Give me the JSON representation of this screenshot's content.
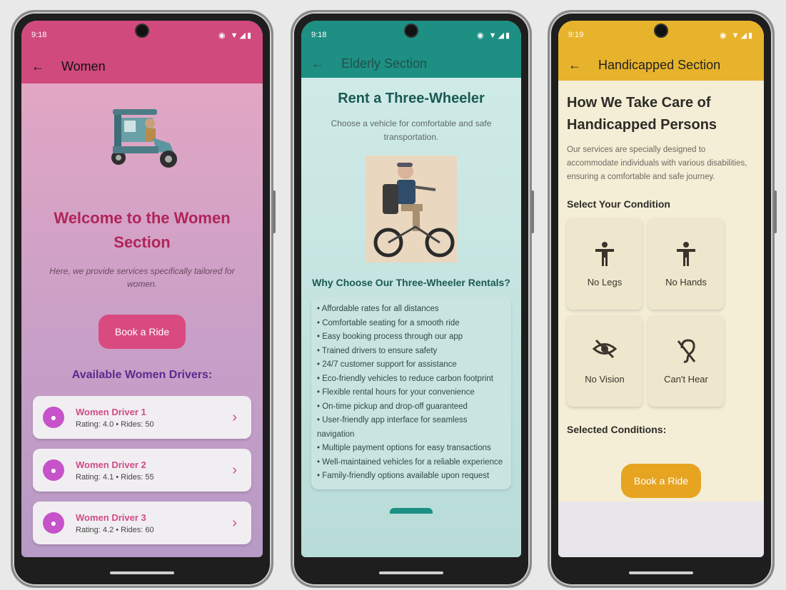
{
  "women": {
    "status_time": "9:18",
    "appbar_title": "Women",
    "welcome_line1": "Welcome to the Women",
    "welcome_line2": "Section",
    "description": "Here, we provide services specifically tailored for women.",
    "book_button": "Book a Ride",
    "drivers_heading": "Available Women Drivers:",
    "drivers": [
      {
        "name": "Women Driver 1",
        "meta": "Rating: 4.0 • Rides: 50"
      },
      {
        "name": "Women Driver 2",
        "meta": "Rating: 4.1 • Rides: 55"
      },
      {
        "name": "Women Driver 3",
        "meta": "Rating: 4.2 • Rides: 60"
      }
    ],
    "colors": {
      "appbar": "#d04a7d",
      "accent": "#d94a80",
      "heading": "#b0245a"
    }
  },
  "elderly": {
    "status_time": "9:18",
    "appbar_title": "Elderly Section",
    "heading": "Rent a Three-Wheeler",
    "subheading": "Choose a vehicle for comfortable and safe transportation.",
    "why_heading": "Why Choose Our Three-Wheeler Rentals?",
    "benefits": [
      "• Affordable rates for all distances",
      "• Comfortable seating for a smooth ride",
      "• Easy booking process through our app",
      "• Trained drivers to ensure safety",
      "• 24/7 customer support for assistance",
      "• Eco-friendly vehicles to reduce carbon footprint",
      "• Flexible rental hours for your convenience",
      "• On-time pickup and drop-off guaranteed",
      "• User-friendly app interface for seamless navigation",
      "• Multiple payment options for easy transactions",
      "• Well-maintained vehicles for a reliable experience",
      "• Family-friendly options available upon request"
    ],
    "colors": {
      "appbar": "#1d8f83",
      "heading": "#1a5a52"
    }
  },
  "handicapped": {
    "status_time": "9:19",
    "appbar_title": "Handicapped Section",
    "heading_line1": "How We Take Care of",
    "heading_line2": "Handicapped Persons",
    "description": "Our services are specially designed to accommodate individuals with various disabilities, ensuring a comfortable and safe journey.",
    "select_heading": "Select Your Condition",
    "conditions": [
      {
        "label": "No Legs",
        "icon": "accessibility-icon"
      },
      {
        "label": "No Hands",
        "icon": "accessibility-icon"
      },
      {
        "label": "No Vision",
        "icon": "visibility-off-icon"
      },
      {
        "label": "Can't Hear",
        "icon": "hearing-disabled-icon"
      }
    ],
    "selected_heading": "Selected Conditions:",
    "book_button": "Book a Ride",
    "colors": {
      "appbar": "#e8b32c",
      "accent": "#e6a420"
    }
  }
}
